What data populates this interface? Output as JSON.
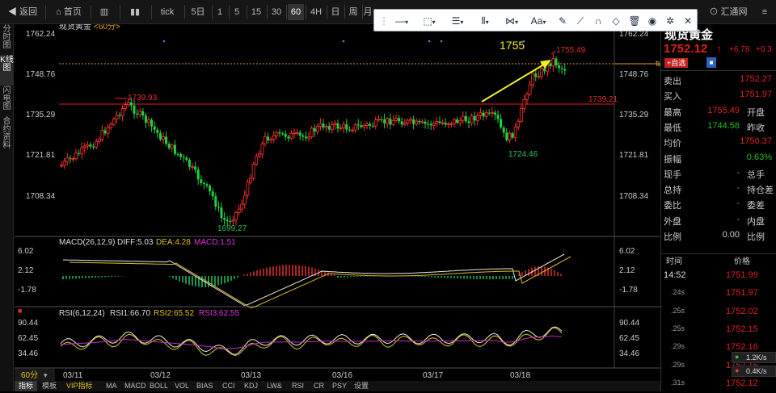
{
  "toolbar": {
    "back": "返回",
    "home": "首页",
    "periods": [
      "tick",
      "5日",
      "1",
      "5",
      "15",
      "30",
      "60",
      "4H",
      "日",
      "周",
      "月"
    ],
    "brand": "汇通网"
  },
  "leftnav": [
    "分时图",
    "K线图",
    "闪电图",
    "合约资料"
  ],
  "chart": {
    "title": "现货黄金",
    "period": "<60分>",
    "price_axis": [
      "1762.24",
      "1748.76",
      "1735.29",
      "1721.81",
      "1708.34"
    ],
    "annotations": {
      "high_label": "1755.49",
      "target_label": "1755",
      "left_peak": "1739.93",
      "resistance": "1739.21",
      "low": "1699.27",
      "local_low": "1724.46"
    },
    "dates": [
      "03/11",
      "03/12",
      "03/13",
      "03/16",
      "03/17",
      "03/18"
    ],
    "period_label": "60分"
  },
  "macd": {
    "header": "MACD(26,12,9)",
    "diff": "DIFF:5.03",
    "dea": "DEA:4.28",
    "macd": "MACD:1.51",
    "axis": [
      "6.02",
      "2.12",
      "-1.78"
    ]
  },
  "rsi": {
    "header": "RSI(6,12,24)",
    "rsi1": "RSI1:66.70",
    "rsi2": "RSI2:65.52",
    "rsi3": "RSI3:62.55",
    "axis": [
      "90.44",
      "62.45",
      "34.46"
    ]
  },
  "bottom_tabs": [
    "指标",
    "模板",
    "VIP指标",
    "MA",
    "MACD",
    "BOLL",
    "VOL",
    "BIAS",
    "CCI",
    "KDJ",
    "LW&",
    "RSI",
    "CR",
    "PSY",
    "设置"
  ],
  "quote": {
    "name": "现货黄金",
    "price": "1752.12",
    "change": "+6.78",
    "pct": "+0.3",
    "tag_self": "自选",
    "rows": [
      {
        "label": "卖出",
        "value": "1752.27",
        "value_color": "#e02020",
        "label2": ""
      },
      {
        "label": "买入",
        "value": "1751.97",
        "value_color": "#e02020",
        "label2": ""
      },
      {
        "label": "最高",
        "value": "1755.49",
        "value_color": "#e02020",
        "label2": "开盘"
      },
      {
        "label": "最低",
        "value": "1744.58",
        "value_color": "#20c020",
        "label2": "昨收"
      },
      {
        "label": "均价",
        "value": "1750.37",
        "value_color": "#e02020",
        "label2": ""
      },
      {
        "label": "振幅",
        "value": "0.63%",
        "value_color": "#20c020",
        "label2": ""
      },
      {
        "label": "现手",
        "value": "-",
        "value_color": "#888888",
        "label2": "总手"
      },
      {
        "label": "总持",
        "value": "-",
        "value_color": "#888888",
        "label2": "持仓差"
      },
      {
        "label": "委比",
        "value": "-",
        "value_color": "#888888",
        "label2": "委差"
      },
      {
        "label": "外盘",
        "value": "-",
        "value_color": "#888888",
        "label2": "内盘"
      },
      {
        "label": "比例",
        "value": "0.00",
        "value_color": "#cccccc",
        "label2": "比例"
      }
    ],
    "tick_header": {
      "time": "时间",
      "price": "价格"
    },
    "ticks": [
      {
        "time": "14:52",
        "price": "1751.99"
      },
      {
        "time": ".24s",
        "price": "1751.97"
      },
      {
        "time": ".25s",
        "price": "1752.02"
      },
      {
        "time": ".25s",
        "price": "1752.15"
      },
      {
        "time": ".29s",
        "price": "1752.16"
      },
      {
        "time": ".29s",
        "price": "1752.16"
      },
      {
        "time": ".31s",
        "price": "1752.12"
      }
    ],
    "speed_up": "1.2K/s",
    "speed_down": "0.4K/s"
  },
  "draw_toolbar": {
    "font_label": "Aa"
  }
}
